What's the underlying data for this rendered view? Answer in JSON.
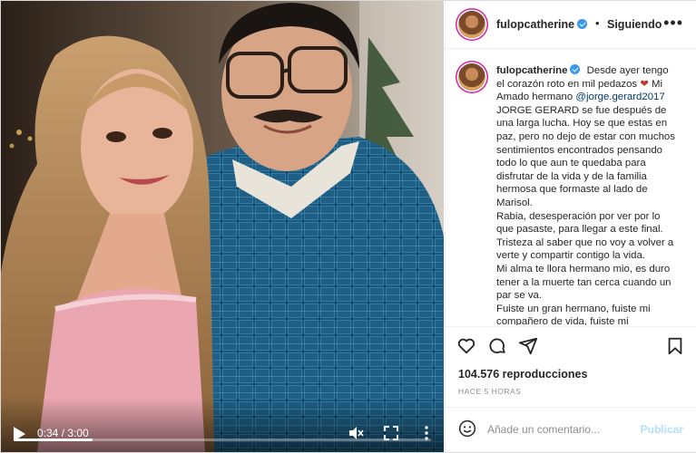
{
  "video": {
    "time": "0:34 / 3:00",
    "progress": 0.19,
    "play_icon": "play-icon",
    "mute_icon": "muted-speaker-icon",
    "fullscreen_icon": "fullscreen-icon",
    "more_icon": "vertical-dots-icon"
  },
  "header": {
    "username": "fulopcatherine",
    "separator": "•",
    "follow_label": "Siguiendo",
    "more_label": "•••"
  },
  "caption": {
    "username": "fulopcatherine",
    "line1_pre": "Desde ayer tengo el corazón roto en mil pedazos",
    "heart": "❤",
    "line1_post": "Mi Amado hermano",
    "mention": "@jorge.gerard2017",
    "para1": "JORGE GERARD se fue después de una larga lucha. Hoy se que estas en paz, pero no dejo de estar con muchos sentimientos encontrados pensando todo lo que aun te quedaba para disfrutar de la vida y de la familia hermosa que formaste al lado de Marisol.",
    "para2": "Rabia, desesperación por ver por lo que pasaste, para llegar a este final. Tristeza al saber que no voy a volver a verte y compartir contigo la vida.",
    "para3": "Mi alma te llora hermano mio, es duro tener a la muerte tan cerca cuando un par se va.",
    "para4": "Fuiste un gran hermano, fuiste mi compañero de vida, fuiste mi confidente"
  },
  "actions": {
    "views": "104.576 reproducciones",
    "ago": "HACE 5 HORAS",
    "icons": [
      "heart-outline-icon",
      "comment-icon",
      "share-icon",
      "bookmark-icon"
    ]
  },
  "comment": {
    "placeholder": "Añade un comentario...",
    "publish_label": "Publicar"
  },
  "colors": {
    "verified": "#3897f0",
    "mention": "#00376b",
    "publish_disabled": "#b2dffc"
  }
}
